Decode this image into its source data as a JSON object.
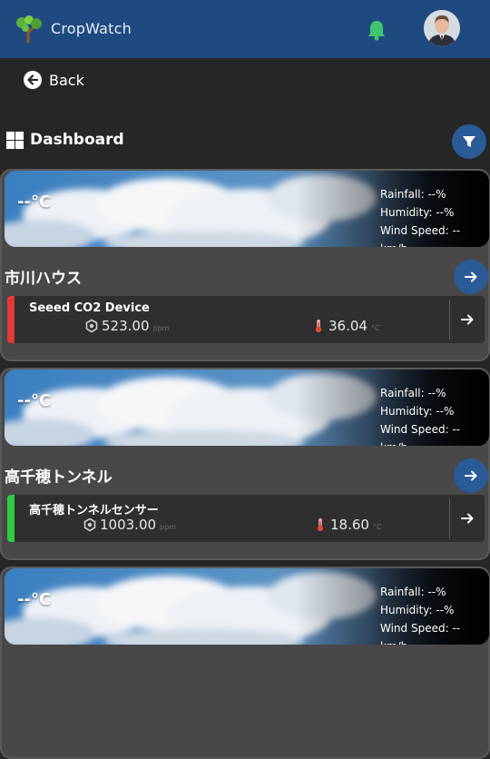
{
  "app": {
    "title": "CropWatch",
    "icons": {
      "logo": "tree-logo-icon",
      "notifications": "bell-icon",
      "avatar": "user-avatar"
    },
    "colors": {
      "header": "#1e4a80",
      "accent": "#2a5b96",
      "bell": "#3ec46d",
      "status_red": "#e53935",
      "status_green": "#2ecc40"
    }
  },
  "nav": {
    "back_label": "Back"
  },
  "dashboard": {
    "title": "Dashboard"
  },
  "farms": [
    {
      "name": "市川ハウス",
      "weather": {
        "temp": "--°C",
        "rainfall": "Rainfall: --%",
        "humidity": "Humidity: --%",
        "wind": "Wind Speed: -- km/h"
      },
      "device": {
        "name": "Seeed CO2 Device",
        "status": "red",
        "co2_value": "523.00",
        "co2_unit": "ppm",
        "temp_value": "36.04",
        "temp_unit": "°C"
      }
    },
    {
      "name": "高千穂トンネル",
      "weather": {
        "temp": "--°C",
        "rainfall": "Rainfall: --%",
        "humidity": "Humidity: --%",
        "wind": "Wind Speed: -- km/h"
      },
      "device": {
        "name": "高千穂トンネルセンサー",
        "status": "green",
        "co2_value": "1003.00",
        "co2_unit": "ppm",
        "temp_value": "18.60",
        "temp_unit": "°C"
      }
    },
    {
      "weather": {
        "temp": "--°C",
        "rainfall": "Rainfall: --%",
        "humidity": "Humidity: --%",
        "wind": "Wind Speed: -- km/h"
      }
    }
  ]
}
